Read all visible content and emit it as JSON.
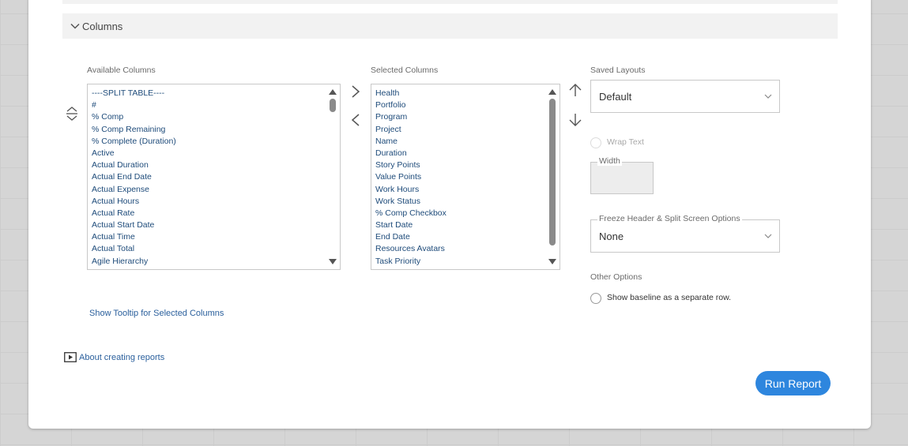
{
  "section": {
    "title": "Columns"
  },
  "available": {
    "label": "Available Columns",
    "items": [
      "----SPLIT TABLE----",
      "#",
      "% Comp",
      "% Comp Remaining",
      "% Complete (Duration)",
      "Active",
      "Actual Duration",
      "Actual End Date",
      "Actual Expense",
      "Actual Hours",
      "Actual Rate",
      "Actual Start Date",
      "Actual Time",
      "Actual Total",
      "Agile Hierarchy"
    ]
  },
  "selected": {
    "label": "Selected Columns",
    "items": [
      "Health",
      "Portfolio",
      "Program",
      "Project",
      "Name",
      "Duration",
      "Story Points",
      "Value Points",
      "Work Hours",
      "Work Status",
      "% Comp Checkbox",
      "Start Date",
      "End Date",
      "Resources Avatars",
      "Task Priority"
    ]
  },
  "saved_layouts": {
    "label": "Saved Layouts",
    "value": "Default"
  },
  "wrap_text": {
    "label": "Wrap Text"
  },
  "width": {
    "label": "Width"
  },
  "freeze": {
    "label": "Freeze Header & Split Screen Options",
    "value": "None"
  },
  "other_options": {
    "label": "Other Options",
    "baseline_label": "Show baseline as a separate row."
  },
  "tooltip_link": "Show Tooltip for Selected Columns",
  "about_link": "About creating reports",
  "run_button": "Run Report",
  "icons": {
    "collapse": "chevron-down-icon",
    "reorder": "reorder-icon",
    "add": "chevron-right-icon",
    "remove": "chevron-left-icon",
    "move_up": "arrow-up-icon",
    "move_down": "arrow-down-icon",
    "video": "play-video-icon"
  },
  "colors": {
    "accent": "#2e86de",
    "link": "#2a5f9c",
    "list_text": "#1e4b7a"
  }
}
